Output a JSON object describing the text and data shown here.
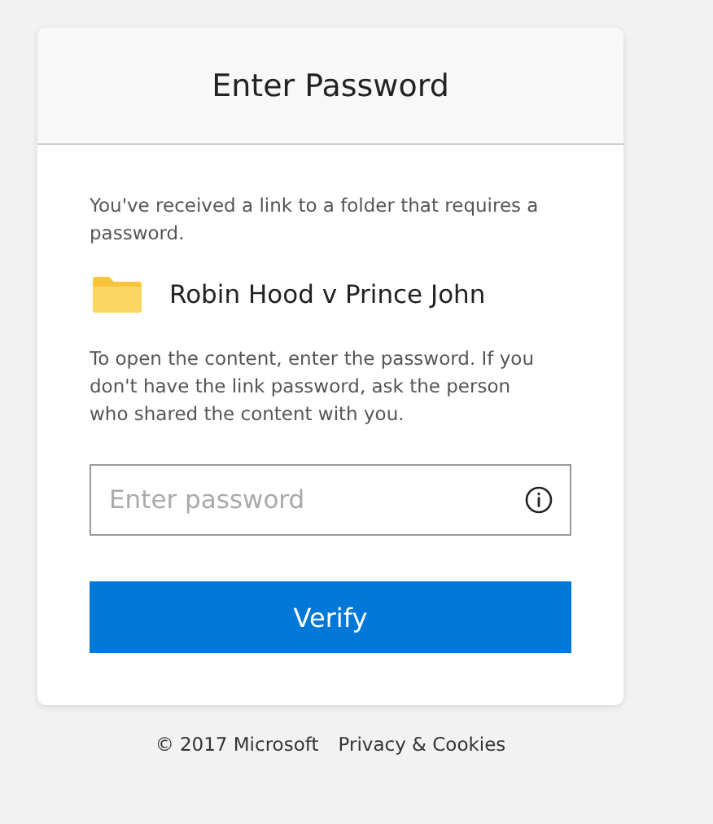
{
  "dialog": {
    "title": "Enter Password",
    "intro": "You've received a link to a folder that requires a password.",
    "folder": {
      "name": "Robin Hood v Prince John"
    },
    "instructions": "To open the content, enter the password. If you don't have the link password, ask the person who shared the content with you.",
    "password_field": {
      "placeholder": "Enter password"
    },
    "button": "Verify"
  },
  "footer": {
    "copyright": "© 2017 Microsoft",
    "link": "Privacy & Cookies"
  }
}
